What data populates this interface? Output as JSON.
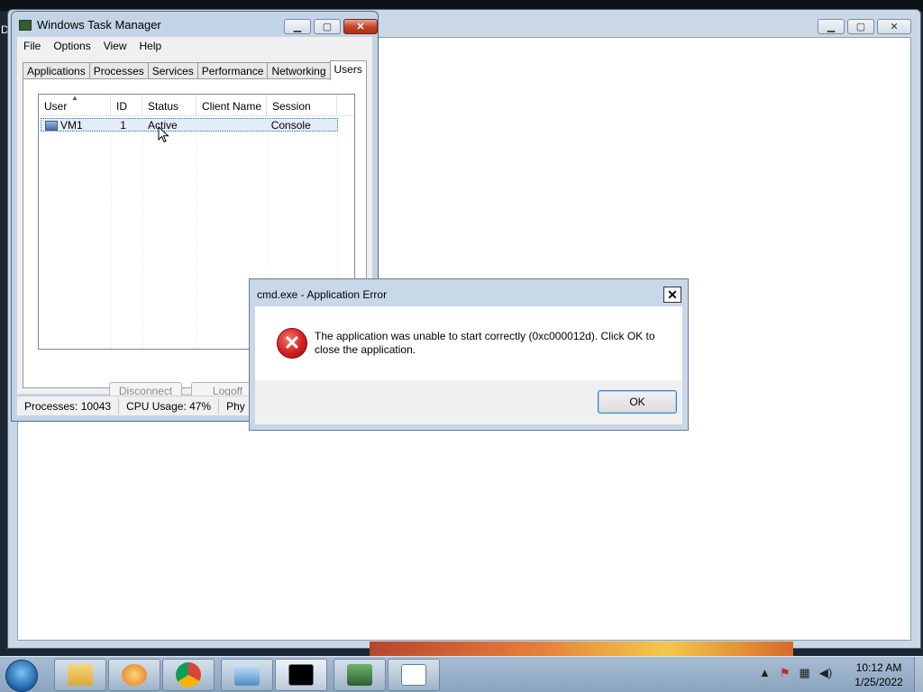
{
  "desktop": {
    "label": "D"
  },
  "taskmgr": {
    "title": "Windows Task Manager",
    "menu": [
      "File",
      "Options",
      "View",
      "Help"
    ],
    "tabs": [
      "Applications",
      "Processes",
      "Services",
      "Performance",
      "Networking",
      "Users"
    ],
    "active_tab": "Users",
    "columns": [
      "User",
      "ID",
      "Status",
      "Client Name",
      "Session"
    ],
    "rows": [
      {
        "user": "VM1",
        "id": "1",
        "status": "Active",
        "client": "",
        "session": "Console"
      }
    ],
    "buttons": {
      "disconnect": "Disconnect",
      "logoff": "Logoff"
    },
    "status": {
      "processes": "Processes: 10043",
      "cpu": "CPU Usage: 47%",
      "mem": "Phy"
    }
  },
  "dialog": {
    "title": "cmd.exe - Application Error",
    "close": "✕",
    "message": "The application was unable to start correctly (0xc000012d). Click OK to close the application.",
    "ok": "OK"
  },
  "taskbar": {
    "items": [
      "file-explorer",
      "media-player",
      "chrome",
      "control-panel",
      "command-prompt",
      "task-manager",
      "notepad"
    ],
    "time": "10:12 AM",
    "date": "1/25/2022"
  },
  "colors": {
    "accent": "#3c7fb1",
    "error": "#d21f1f"
  }
}
